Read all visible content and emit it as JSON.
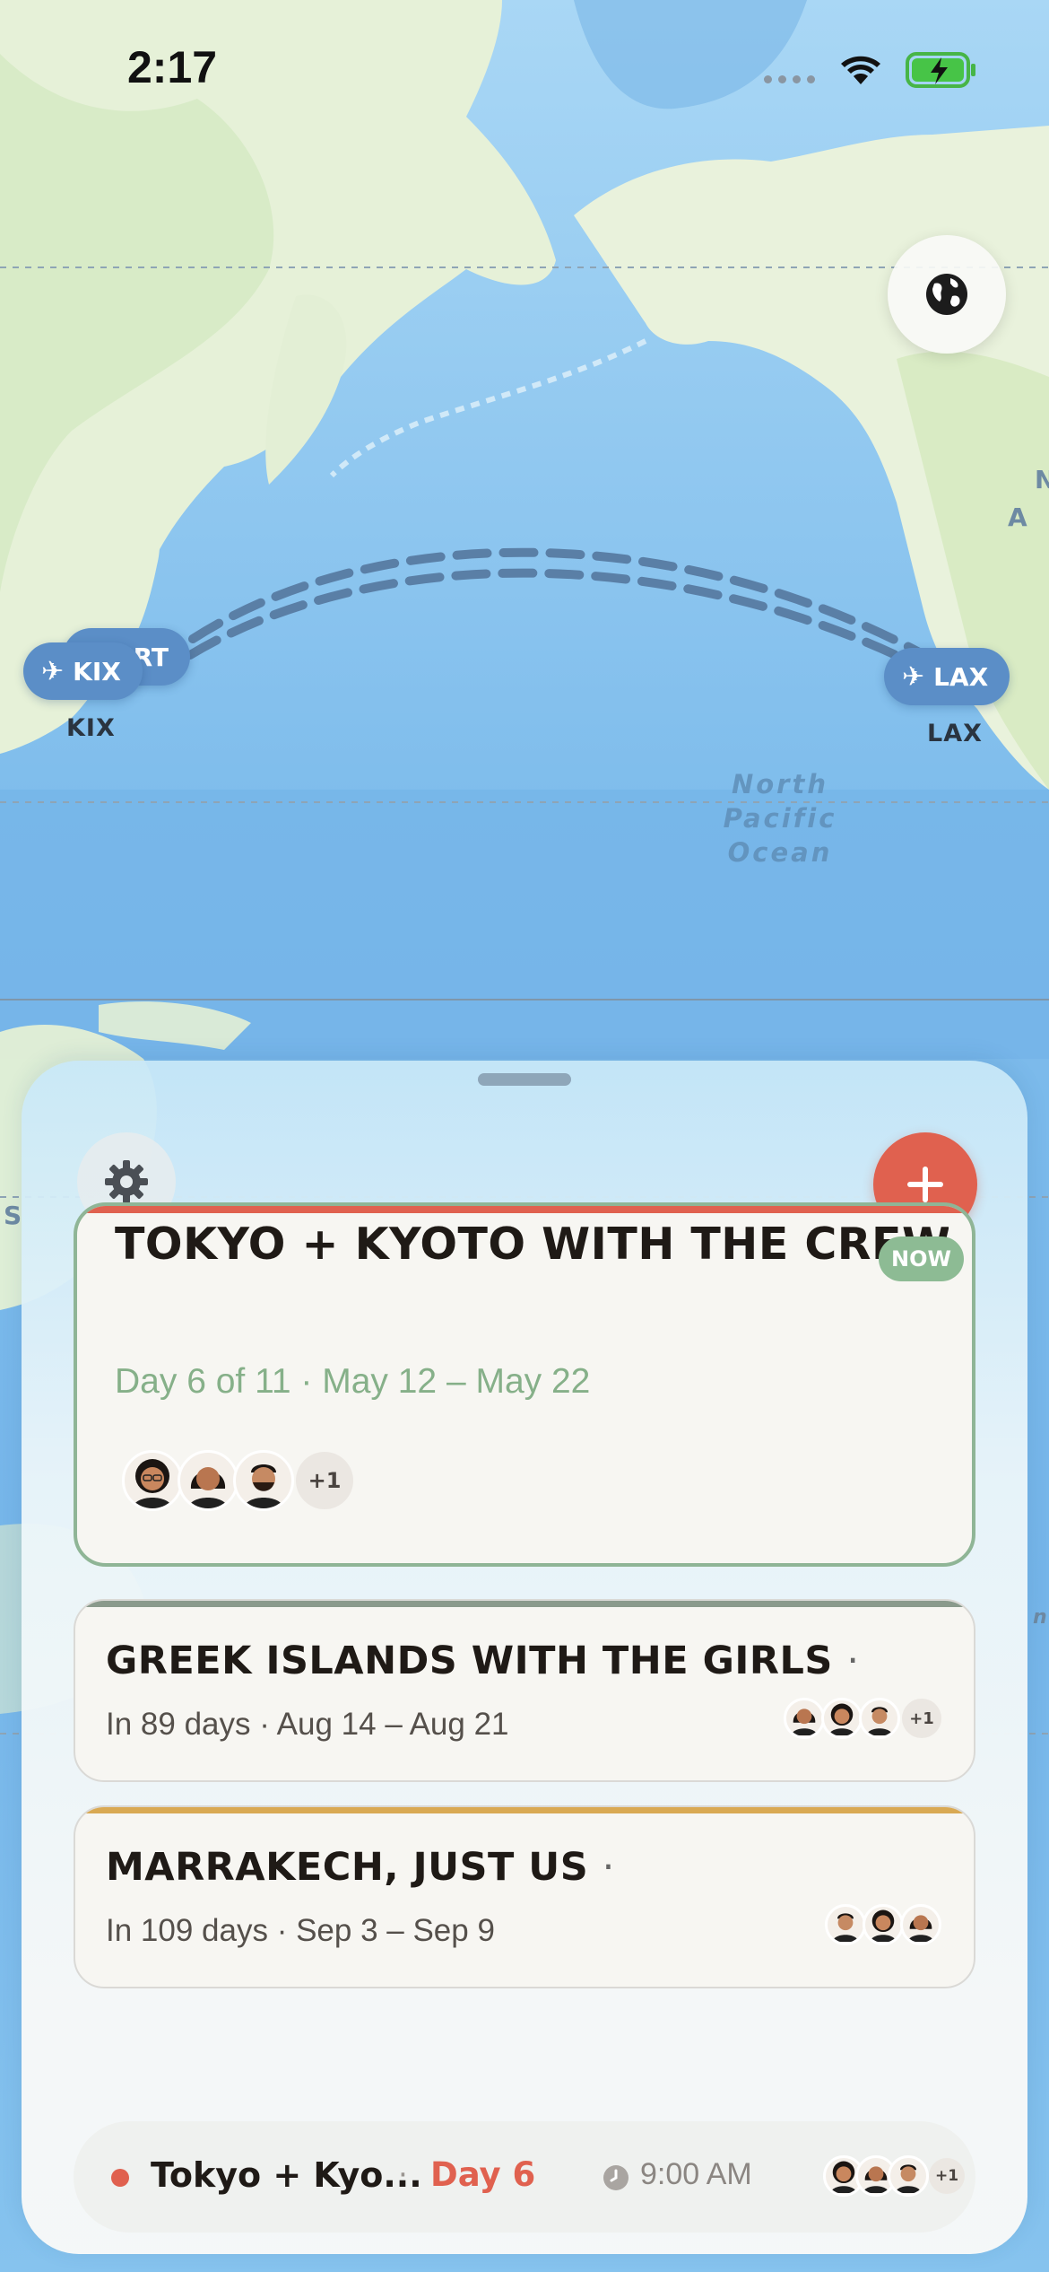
{
  "status_bar": {
    "time": "2:17"
  },
  "map": {
    "ocean_label": [
      "North",
      "Pacific",
      "Ocean"
    ],
    "edge_labels": [
      "N",
      "A",
      "S",
      "n"
    ],
    "airports": [
      {
        "pin_label": "KIX",
        "code_label": "KIX"
      },
      {
        "pin_label": "NRT"
      },
      {
        "pin_label": "LAX",
        "code_label": "LAX"
      }
    ]
  },
  "trips": {
    "current": {
      "title": "TOKYO + KYOTO WITH THE CREW",
      "badge": "NOW",
      "dates": "Day 6 of 11 · May 12 – May 22",
      "more_travelers": "+1",
      "accent_color": "#e0614f"
    },
    "upcoming": [
      {
        "title": "GREEK ISLANDS WITH THE GIRLS",
        "subtitle": "In 89 days · Aug 14 – Aug 21",
        "more_travelers": "+1",
        "accent_color": "#8a9a8c"
      },
      {
        "title": "MARRAKECH, JUST US",
        "subtitle": "In 109 days · Sep 3 – Sep 9",
        "accent_color": "#d9a953"
      }
    ]
  },
  "mini_bar": {
    "trip": "Tokyo + Kyo...",
    "day": "Day 6",
    "time": "9:00 AM",
    "more_travelers": "+1"
  },
  "icons": [
    "globe-icon",
    "gear-icon",
    "plus-icon",
    "plane-icon",
    "clock-icon",
    "wifi-icon",
    "battery-icon"
  ]
}
